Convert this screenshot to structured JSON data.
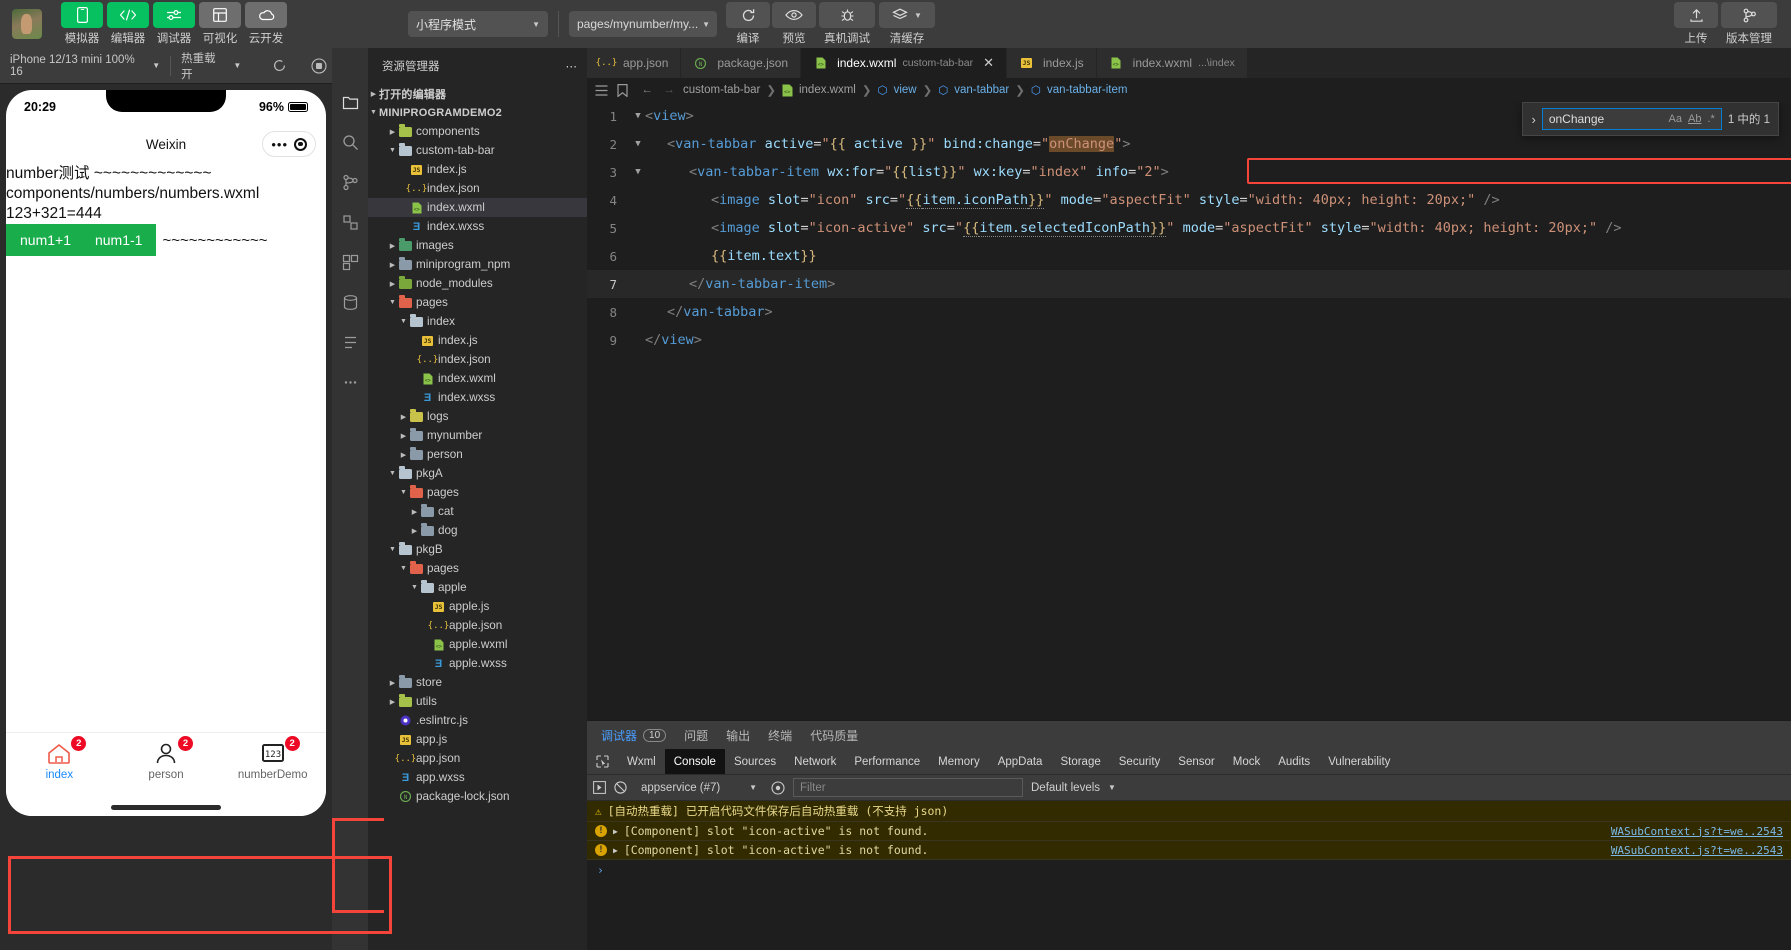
{
  "topbar": {
    "tools": [
      {
        "label": "模拟器",
        "icon": "phone-icon",
        "style": "green"
      },
      {
        "label": "编辑器",
        "icon": "code-icon",
        "style": "green"
      },
      {
        "label": "调试器",
        "icon": "sliders-icon",
        "style": "green"
      },
      {
        "label": "可视化",
        "icon": "layout-icon",
        "style": "grey"
      },
      {
        "label": "云开发",
        "icon": "cloud-icon",
        "style": "grey"
      }
    ],
    "mode_select": "小程序模式",
    "page_select": "pages/mynumber/my...",
    "actions": [
      {
        "label": "编译",
        "icon": "refresh-icon"
      },
      {
        "label": "预览",
        "icon": "eye-icon"
      },
      {
        "label": "真机调试",
        "icon": "bug-icon"
      },
      {
        "label": "清缓存",
        "icon": "layers-icon"
      }
    ],
    "right_actions": [
      {
        "label": "上传",
        "icon": "upload-icon"
      },
      {
        "label": "版本管理",
        "icon": "branch-icon"
      }
    ]
  },
  "simulator": {
    "toolbar": {
      "device": "iPhone 12/13 mini 100% 16",
      "hotreload": "热重载 开",
      "refresh_icon": "refresh-icon",
      "record_icon": "record-icon",
      "more_icon": "more-icon"
    },
    "phone": {
      "time": "20:29",
      "battery": "96%",
      "nav_title": "Weixin",
      "capsule_dots": "•••",
      "lines": [
        "number测试 ~~~~~~~~~~~~~",
        "components/numbers/numbers.wxml",
        "123+321=444"
      ],
      "buttons": [
        "num1+1",
        "num1-1"
      ],
      "trailing_tilde": "~~~~~~~~~~~~",
      "tabbar": [
        {
          "label": "index",
          "badge": "2",
          "icon": "home-icon",
          "active": true
        },
        {
          "label": "person",
          "badge": "2",
          "icon": "user-icon",
          "active": false
        },
        {
          "label": "numberDemo",
          "badge": "2",
          "icon": "number-icon",
          "active": false
        }
      ]
    }
  },
  "explorer": {
    "title": "资源管理器",
    "more_icon": "more-icon",
    "open_editors": "打开的编辑器",
    "project": "MINIPROGRAMDEMO2",
    "tree": [
      {
        "label": "components",
        "depth": 1,
        "type": "folder-special",
        "arrow": "right"
      },
      {
        "label": "custom-tab-bar",
        "depth": 1,
        "type": "folder",
        "arrow": "down"
      },
      {
        "label": "index.js",
        "depth": 2,
        "type": "js"
      },
      {
        "label": "index.json",
        "depth": 2,
        "type": "json"
      },
      {
        "label": "index.wxml",
        "depth": 2,
        "type": "wxml",
        "selected": true
      },
      {
        "label": "index.wxss",
        "depth": 2,
        "type": "wxss"
      },
      {
        "label": "images",
        "depth": 1,
        "type": "folder-img",
        "arrow": "right"
      },
      {
        "label": "miniprogram_npm",
        "depth": 1,
        "type": "folder-blue",
        "arrow": "right"
      },
      {
        "label": "node_modules",
        "depth": 1,
        "type": "folder-node",
        "arrow": "right"
      },
      {
        "label": "pages",
        "depth": 1,
        "type": "folder-pages",
        "arrow": "down"
      },
      {
        "label": "index",
        "depth": 2,
        "type": "folder",
        "arrow": "down"
      },
      {
        "label": "index.js",
        "depth": 3,
        "type": "js"
      },
      {
        "label": "index.json",
        "depth": 3,
        "type": "json"
      },
      {
        "label": "index.wxml",
        "depth": 3,
        "type": "wxml"
      },
      {
        "label": "index.wxss",
        "depth": 3,
        "type": "wxss"
      },
      {
        "label": "logs",
        "depth": 2,
        "type": "folder-logs",
        "arrow": "right"
      },
      {
        "label": "mynumber",
        "depth": 2,
        "type": "folder-blue",
        "arrow": "right"
      },
      {
        "label": "person",
        "depth": 2,
        "type": "folder-blue",
        "arrow": "right"
      },
      {
        "label": "pkgA",
        "depth": 1,
        "type": "folder",
        "arrow": "down"
      },
      {
        "label": "pages",
        "depth": 2,
        "type": "folder-pages",
        "arrow": "down"
      },
      {
        "label": "cat",
        "depth": 3,
        "type": "folder-blue",
        "arrow": "right"
      },
      {
        "label": "dog",
        "depth": 3,
        "type": "folder-blue",
        "arrow": "right"
      },
      {
        "label": "pkgB",
        "depth": 1,
        "type": "folder",
        "arrow": "down"
      },
      {
        "label": "pages",
        "depth": 2,
        "type": "folder-pages",
        "arrow": "down"
      },
      {
        "label": "apple",
        "depth": 3,
        "type": "folder",
        "arrow": "down"
      },
      {
        "label": "apple.js",
        "depth": 4,
        "type": "js"
      },
      {
        "label": "apple.json",
        "depth": 4,
        "type": "json"
      },
      {
        "label": "apple.wxml",
        "depth": 4,
        "type": "wxml"
      },
      {
        "label": "apple.wxss",
        "depth": 4,
        "type": "wxss"
      },
      {
        "label": "store",
        "depth": 1,
        "type": "folder-blue",
        "arrow": "right"
      },
      {
        "label": "utils",
        "depth": 1,
        "type": "folder-special",
        "arrow": "right"
      },
      {
        "label": ".eslintrc.js",
        "depth": 1,
        "type": "eslint"
      },
      {
        "label": "app.js",
        "depth": 1,
        "type": "js"
      },
      {
        "label": "app.json",
        "depth": 1,
        "type": "json"
      },
      {
        "label": "app.wxss",
        "depth": 1,
        "type": "wxss"
      },
      {
        "label": "package-lock.json",
        "depth": 1,
        "type": "npm"
      }
    ]
  },
  "editor": {
    "tabs": [
      {
        "label": "app.json",
        "sub": "",
        "type": "json",
        "active": false,
        "closable": false
      },
      {
        "label": "package.json",
        "sub": "",
        "type": "npm",
        "active": false,
        "closable": false
      },
      {
        "label": "index.wxml",
        "sub": "custom-tab-bar",
        "type": "wxml",
        "active": true,
        "closable": true
      },
      {
        "label": "index.js",
        "sub": "",
        "type": "js",
        "active": false,
        "closable": false
      },
      {
        "label": "index.wxml",
        "sub": "...\\index",
        "type": "wxml",
        "active": false,
        "closable": false
      }
    ],
    "breadcrumb": [
      "custom-tab-bar",
      "index.wxml",
      "view",
      "van-tabbar",
      "van-tabbar-item"
    ],
    "close_label": "✕",
    "find": {
      "query": "onChange",
      "count": "1 中的 1",
      "case_icon": "Aa",
      "word_icon": "Ab",
      "regex_icon": ".*",
      "chevron_icon": "›"
    },
    "code_lines": [
      {
        "num": "1",
        "fold": "down",
        "indent": 0,
        "tokens": [
          {
            "t": "<",
            "c": "t-br"
          },
          {
            "t": "view",
            "c": "t-tag"
          },
          {
            "t": ">",
            "c": "t-br"
          }
        ]
      },
      {
        "num": "2",
        "fold": "down",
        "indent": 1,
        "tokens": [
          {
            "t": "<",
            "c": "t-br"
          },
          {
            "t": "van-tabbar",
            "c": "t-tag"
          },
          {
            "t": " ",
            "c": "t-plain"
          },
          {
            "t": "active",
            "c": "t-attr"
          },
          {
            "t": "=",
            "c": "t-plain"
          },
          {
            "t": "\"",
            "c": "t-str"
          },
          {
            "t": "{{",
            "c": "t-mus"
          },
          {
            "t": " active ",
            "c": "t-attr"
          },
          {
            "t": "}}",
            "c": "t-mus"
          },
          {
            "t": "\"",
            "c": "t-str"
          },
          {
            "t": " ",
            "c": "t-plain"
          },
          {
            "t": "bind:change",
            "c": "t-attr"
          },
          {
            "t": "=",
            "c": "t-plain"
          },
          {
            "t": "\"",
            "c": "t-str"
          },
          {
            "t": "onChange",
            "c": "t-str hl-word"
          },
          {
            "t": "\"",
            "c": "t-str"
          },
          {
            "t": ">",
            "c": "t-br"
          }
        ]
      },
      {
        "num": "3",
        "fold": "down",
        "indent": 2,
        "highlight": true,
        "tokens": [
          {
            "t": "<",
            "c": "t-br"
          },
          {
            "t": "van-tabbar-item",
            "c": "t-tag"
          },
          {
            "t": " ",
            "c": "t-plain"
          },
          {
            "t": "wx:for",
            "c": "t-attr"
          },
          {
            "t": "=",
            "c": "t-plain"
          },
          {
            "t": "\"",
            "c": "t-str"
          },
          {
            "t": "{{",
            "c": "t-mus"
          },
          {
            "t": "list",
            "c": "t-attr"
          },
          {
            "t": "}}",
            "c": "t-mus"
          },
          {
            "t": "\"",
            "c": "t-str"
          },
          {
            "t": " ",
            "c": "t-plain"
          },
          {
            "t": "wx:key",
            "c": "t-attr"
          },
          {
            "t": "=",
            "c": "t-plain"
          },
          {
            "t": "\"index\"",
            "c": "t-str"
          },
          {
            "t": " ",
            "c": "t-plain"
          },
          {
            "t": "info",
            "c": "t-attr"
          },
          {
            "t": "=",
            "c": "t-plain"
          },
          {
            "t": "\"2\"",
            "c": "t-str"
          },
          {
            "t": ">",
            "c": "t-br"
          }
        ]
      },
      {
        "num": "4",
        "fold": "",
        "indent": 3,
        "tokens": [
          {
            "t": "<",
            "c": "t-br"
          },
          {
            "t": "image",
            "c": "t-tag"
          },
          {
            "t": " ",
            "c": "t-plain"
          },
          {
            "t": "slot",
            "c": "t-attr"
          },
          {
            "t": "=",
            "c": "t-plain"
          },
          {
            "t": "\"icon\"",
            "c": "t-str"
          },
          {
            "t": " ",
            "c": "t-plain"
          },
          {
            "t": "src",
            "c": "t-attr"
          },
          {
            "t": "=",
            "c": "t-plain"
          },
          {
            "t": "\"",
            "c": "t-str"
          },
          {
            "t": "{{",
            "c": "t-mus underl"
          },
          {
            "t": "item.iconPath",
            "c": "t-attr underl"
          },
          {
            "t": "}}",
            "c": "t-mus underl"
          },
          {
            "t": "\"",
            "c": "t-str"
          },
          {
            "t": " ",
            "c": "t-plain"
          },
          {
            "t": "mode",
            "c": "t-attr"
          },
          {
            "t": "=",
            "c": "t-plain"
          },
          {
            "t": "\"aspectFit\"",
            "c": "t-str"
          },
          {
            "t": " ",
            "c": "t-plain"
          },
          {
            "t": "style",
            "c": "t-attr"
          },
          {
            "t": "=",
            "c": "t-plain"
          },
          {
            "t": "\"width: 40px; height: 20px;\"",
            "c": "t-str"
          },
          {
            "t": " ",
            "c": "t-plain"
          },
          {
            "t": "/>",
            "c": "t-br"
          }
        ]
      },
      {
        "num": "5",
        "fold": "",
        "indent": 3,
        "tokens": [
          {
            "t": "<",
            "c": "t-br"
          },
          {
            "t": "image",
            "c": "t-tag"
          },
          {
            "t": " ",
            "c": "t-plain"
          },
          {
            "t": "slot",
            "c": "t-attr"
          },
          {
            "t": "=",
            "c": "t-plain"
          },
          {
            "t": "\"icon-active\"",
            "c": "t-str"
          },
          {
            "t": " ",
            "c": "t-plain"
          },
          {
            "t": "src",
            "c": "t-attr"
          },
          {
            "t": "=",
            "c": "t-plain"
          },
          {
            "t": "\"",
            "c": "t-str"
          },
          {
            "t": "{{",
            "c": "t-mus underl"
          },
          {
            "t": "item.selectedIconPath",
            "c": "t-attr underl"
          },
          {
            "t": "}}",
            "c": "t-mus underl"
          },
          {
            "t": "\"",
            "c": "t-str"
          },
          {
            "t": " ",
            "c": "t-plain"
          },
          {
            "t": "mode",
            "c": "t-attr"
          },
          {
            "t": "=",
            "c": "t-plain"
          },
          {
            "t": "\"aspectFit\"",
            "c": "t-str"
          },
          {
            "t": " ",
            "c": "t-plain"
          },
          {
            "t": "style",
            "c": "t-attr"
          },
          {
            "t": "=",
            "c": "t-plain"
          },
          {
            "t": "\"width: 40px; height: 20px;\"",
            "c": "t-str"
          },
          {
            "t": " ",
            "c": "t-plain"
          },
          {
            "t": "/>",
            "c": "t-br"
          }
        ]
      },
      {
        "num": "6",
        "fold": "",
        "indent": 3,
        "tokens": [
          {
            "t": "{{",
            "c": "t-mus"
          },
          {
            "t": "item.text",
            "c": "t-attr"
          },
          {
            "t": "}}",
            "c": "t-mus"
          }
        ]
      },
      {
        "num": "7",
        "fold": "",
        "indent": 2,
        "current": true,
        "tokens": [
          {
            "t": "</",
            "c": "t-br"
          },
          {
            "t": "van-tabbar-item",
            "c": "t-tag"
          },
          {
            "t": ">",
            "c": "t-br"
          }
        ]
      },
      {
        "num": "8",
        "fold": "",
        "indent": 1,
        "tokens": [
          {
            "t": "</",
            "c": "t-br"
          },
          {
            "t": "van-tabbar",
            "c": "t-tag"
          },
          {
            "t": ">",
            "c": "t-br"
          }
        ]
      },
      {
        "num": "9",
        "fold": "",
        "indent": 0,
        "tokens": [
          {
            "t": "</",
            "c": "t-br"
          },
          {
            "t": "view",
            "c": "t-tag"
          },
          {
            "t": ">",
            "c": "t-br"
          }
        ]
      }
    ]
  },
  "devtools": {
    "panel_tabs": [
      {
        "label": "调试器",
        "count": "10",
        "active": true
      },
      {
        "label": "问题",
        "count": "",
        "active": false
      },
      {
        "label": "输出",
        "count": "",
        "active": false
      },
      {
        "label": "终端",
        "count": "",
        "active": false
      },
      {
        "label": "代码质量",
        "count": "",
        "active": false
      }
    ],
    "inspector_icon": "inspect-icon",
    "tabs": [
      "Wxml",
      "Console",
      "Sources",
      "Network",
      "Performance",
      "Memory",
      "AppData",
      "Storage",
      "Security",
      "Sensor",
      "Mock",
      "Audits",
      "Vulnerability"
    ],
    "active_tab": "Console",
    "console_bar": {
      "run_icon": "run-icon",
      "clear_icon": "clear-icon",
      "context": "appservice (#7)",
      "eye_icon": "eye-icon",
      "filter_placeholder": "Filter",
      "levels": "Default levels"
    },
    "logs": [
      {
        "kind": "warn",
        "icon": "warning-icon",
        "text": "[自动热重载] 已开启代码文件保存后自动热重载 (不支持 json)",
        "source": ""
      },
      {
        "kind": "error",
        "icon": "error-icon",
        "text": "[Component] slot \"icon-active\" is not found.",
        "source": "WASubContext.js?t=we..2543"
      },
      {
        "kind": "error",
        "icon": "error-icon",
        "text": "[Component] slot \"icon-active\" is not found.",
        "source": "WASubContext.js?t=we..2543"
      }
    ],
    "prompt": "›"
  }
}
